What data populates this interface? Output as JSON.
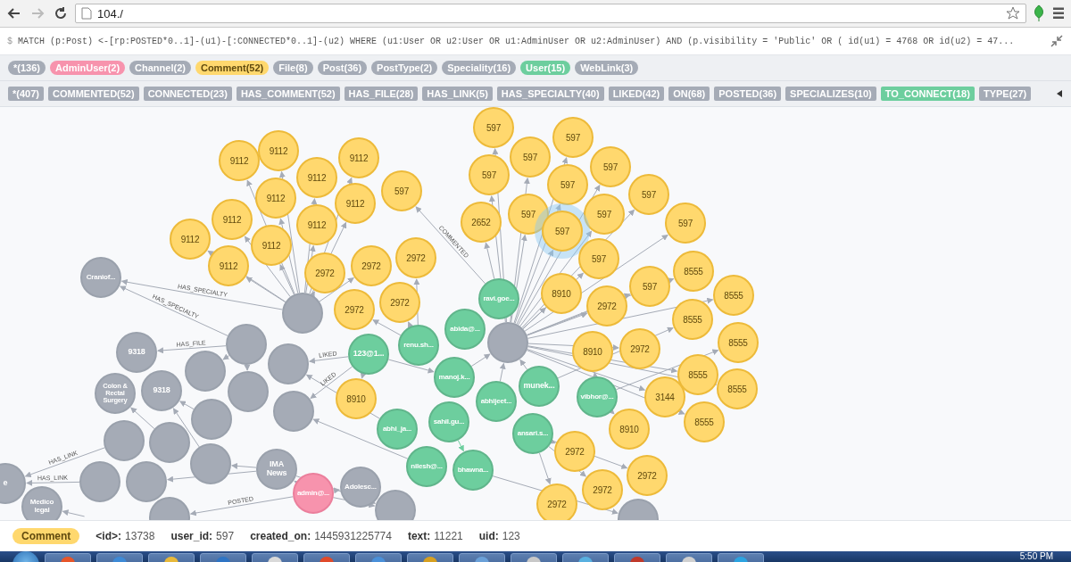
{
  "browser": {
    "url": "104./"
  },
  "query": {
    "prompt": "$",
    "text": "MATCH (p:Post) <-[rp:POSTED*0..1]-(u1)-[:CONNECTED*0..1]-(u2) WHERE (u1:User OR u2:User OR u1:AdminUser OR u2:AdminUser) AND (p.visibility = 'Public' OR ( id(u1) = 4768 OR id(u2) = 47..."
  },
  "labels": [
    {
      "text": "*(136)",
      "color": "#a5abb6"
    },
    {
      "text": "AdminUser(2)",
      "color": "#f793ad"
    },
    {
      "text": "Channel(2)",
      "color": "#a5abb6"
    },
    {
      "text": "Comment(52)",
      "color": "#ffd86e"
    },
    {
      "text": "File(8)",
      "color": "#a5abb6"
    },
    {
      "text": "Post(36)",
      "color": "#a5abb6"
    },
    {
      "text": "PostType(2)",
      "color": "#a5abb6"
    },
    {
      "text": "Speciality(16)",
      "color": "#a5abb6"
    },
    {
      "text": "User(15)",
      "color": "#6dce9e"
    },
    {
      "text": "WebLink(3)",
      "color": "#a5abb6"
    }
  ],
  "relationships": [
    {
      "text": "*(407)",
      "color": "#a5abb6"
    },
    {
      "text": "COMMENTED(52)",
      "color": "#a5abb6"
    },
    {
      "text": "CONNECTED(23)",
      "color": "#a5abb6"
    },
    {
      "text": "HAS_COMMENT(52)",
      "color": "#a5abb6"
    },
    {
      "text": "HAS_FILE(28)",
      "color": "#a5abb6"
    },
    {
      "text": "HAS_LINK(5)",
      "color": "#a5abb6"
    },
    {
      "text": "HAS_SPECIALTY(40)",
      "color": "#a5abb6"
    },
    {
      "text": "LIKED(42)",
      "color": "#a5abb6"
    },
    {
      "text": "ON(68)",
      "color": "#a5abb6"
    },
    {
      "text": "POSTED(36)",
      "color": "#a5abb6"
    },
    {
      "text": "SPECIALIZES(10)",
      "color": "#a5abb6"
    },
    {
      "text": "TO_CONNECT(18)",
      "color": "#6dce9e"
    },
    {
      "text": "TYPE(27)",
      "color": "#a5abb6"
    }
  ],
  "graph": {
    "nodes": [
      {
        "label": "9112",
        "kind": "comment",
        "selected": false
      },
      {
        "label": "9112",
        "kind": "comment",
        "selected": false
      },
      {
        "label": "9112",
        "kind": "comment",
        "selected": false
      },
      {
        "label": "9112",
        "kind": "comment",
        "selected": false
      },
      {
        "label": "9112",
        "kind": "comment",
        "selected": false
      },
      {
        "label": "9112",
        "kind": "comment",
        "selected": false
      },
      {
        "label": "9112",
        "kind": "comment",
        "selected": false
      },
      {
        "label": "9112",
        "kind": "comment",
        "selected": false
      },
      {
        "label": "9112",
        "kind": "comment",
        "selected": false
      },
      {
        "label": "9112",
        "kind": "comment",
        "selected": false
      },
      {
        "label": "9112",
        "kind": "comment",
        "selected": false
      },
      {
        "label": "597",
        "kind": "comment",
        "selected": false
      },
      {
        "label": "597",
        "kind": "comment",
        "selected": false
      },
      {
        "label": "597",
        "kind": "comment",
        "selected": false
      },
      {
        "label": "597",
        "kind": "comment",
        "selected": false
      },
      {
        "label": "597",
        "kind": "comment",
        "selected": false
      },
      {
        "label": "597",
        "kind": "comment",
        "selected": false
      },
      {
        "label": "597",
        "kind": "comment",
        "selected": false
      },
      {
        "label": "597",
        "kind": "comment",
        "selected": false
      },
      {
        "label": "597",
        "kind": "comment",
        "selected": false
      },
      {
        "label": "597",
        "kind": "comment",
        "selected": false
      },
      {
        "label": "597",
        "kind": "comment",
        "selected": false
      },
      {
        "label": "597",
        "kind": "comment",
        "selected": true
      },
      {
        "label": "597",
        "kind": "comment",
        "selected": false
      },
      {
        "label": "597",
        "kind": "comment",
        "selected": false
      },
      {
        "label": "2652",
        "kind": "comment",
        "selected": false
      },
      {
        "label": "2972",
        "kind": "comment",
        "selected": false
      },
      {
        "label": "2972",
        "kind": "comment",
        "selected": false
      },
      {
        "label": "2972",
        "kind": "comment",
        "selected": false
      },
      {
        "label": "2972",
        "kind": "comment",
        "selected": false
      },
      {
        "label": "2972",
        "kind": "comment",
        "selected": false
      },
      {
        "label": "8910",
        "kind": "comment",
        "selected": false
      },
      {
        "label": "2972",
        "kind": "comment",
        "selected": false
      },
      {
        "label": "8555",
        "kind": "comment",
        "selected": false
      },
      {
        "label": "8555",
        "kind": "comment",
        "selected": false
      },
      {
        "label": "8555",
        "kind": "comment",
        "selected": false
      },
      {
        "label": "8555",
        "kind": "comment",
        "selected": false
      },
      {
        "label": "8555",
        "kind": "comment",
        "selected": false
      },
      {
        "label": "8555",
        "kind": "comment",
        "selected": false
      },
      {
        "label": "8555",
        "kind": "comment",
        "selected": false
      },
      {
        "label": "8910",
        "kind": "comment",
        "selected": false
      },
      {
        "label": "2972",
        "kind": "comment",
        "selected": false
      },
      {
        "label": "3144",
        "kind": "comment",
        "selected": false
      },
      {
        "label": "8910",
        "kind": "comment",
        "selected": false
      },
      {
        "label": "2972",
        "kind": "comment",
        "selected": false
      },
      {
        "label": "2972",
        "kind": "comment",
        "selected": false
      },
      {
        "label": "2972",
        "kind": "comment",
        "selected": false
      },
      {
        "label": "2972",
        "kind": "comment",
        "selected": false
      },
      {
        "label": "8910",
        "kind": "comment",
        "selected": false
      },
      {
        "label": "ravi.goe...",
        "kind": "user",
        "selected": false
      },
      {
        "label": "abida@...",
        "kind": "user",
        "selected": false
      },
      {
        "label": "renu.sh...",
        "kind": "user",
        "selected": false
      },
      {
        "label": "123@1...",
        "kind": "user",
        "selected": false
      },
      {
        "label": "manoj.k...",
        "kind": "user",
        "selected": false
      },
      {
        "label": "abhijeet...",
        "kind": "user",
        "selected": false
      },
      {
        "label": "munek...",
        "kind": "user",
        "selected": false
      },
      {
        "label": "vibhor@...",
        "kind": "user",
        "selected": false
      },
      {
        "label": "abhi_ja...",
        "kind": "user",
        "selected": false
      },
      {
        "label": "sahil.gu...",
        "kind": "user",
        "selected": false
      },
      {
        "label": "ansari.s...",
        "kind": "user",
        "selected": false
      },
      {
        "label": "nilesh@...",
        "kind": "user",
        "selected": false
      },
      {
        "label": "bhawna...",
        "kind": "user",
        "selected": false
      },
      {
        "label": "admin@...",
        "kind": "admin",
        "selected": false
      },
      {
        "label": "Craniof...",
        "kind": "other",
        "selected": false
      },
      {
        "label": "9318",
        "kind": "other",
        "selected": false
      },
      {
        "label": "Colon & Rectal Surgery",
        "kind": "other",
        "selected": false
      },
      {
        "label": "9318",
        "kind": "other",
        "selected": false
      },
      {
        "label": "IMA News",
        "kind": "other",
        "selected": false
      },
      {
        "label": "Adolesc...",
        "kind": "other",
        "selected": false
      },
      {
        "label": "Medico legal",
        "kind": "other",
        "selected": false
      },
      {
        "label": "e",
        "kind": "other",
        "selected": false
      },
      {
        "kind": "other",
        "selected": false
      },
      {
        "kind": "other",
        "selected": false
      },
      {
        "kind": "other",
        "selected": false
      },
      {
        "kind": "other",
        "selected": false
      },
      {
        "kind": "other",
        "selected": false
      },
      {
        "kind": "other",
        "selected": false
      },
      {
        "kind": "other",
        "selected": false
      },
      {
        "kind": "other",
        "selected": false
      },
      {
        "kind": "other",
        "selected": false
      },
      {
        "kind": "other",
        "selected": false
      },
      {
        "kind": "other",
        "selected": false
      },
      {
        "kind": "other",
        "selected": false
      },
      {
        "kind": "other",
        "selected": false
      },
      {
        "kind": "other",
        "selected": false
      },
      {
        "kind": "other",
        "selected": false
      },
      {
        "kind": "other",
        "selected": false
      }
    ],
    "edges": [
      {
        "type": "HAS_SPECIALTY"
      },
      {
        "type": "HAS_SPECIALTY"
      },
      {
        "type": "HAS_FILE"
      },
      {
        "type": "COMMENTED"
      },
      {
        "type": "LIKED"
      },
      {
        "type": "LIKED"
      },
      {
        "type": "HAS_LINK"
      },
      {
        "type": "HAS_LINK"
      },
      {
        "type": "POSTED"
      }
    ]
  },
  "inspector": {
    "label": {
      "text": "Comment",
      "color": "#ffd86e"
    },
    "properties": [
      {
        "key": "<id>:",
        "value": "13738"
      },
      {
        "key": "user_id:",
        "value": "597"
      },
      {
        "key": "created_on:",
        "value": "1445931225774"
      },
      {
        "key": "text:",
        "value": "11221"
      },
      {
        "key": "uid:",
        "value": "123"
      }
    ]
  },
  "taskbar": {
    "clock": "5:50 PM"
  }
}
